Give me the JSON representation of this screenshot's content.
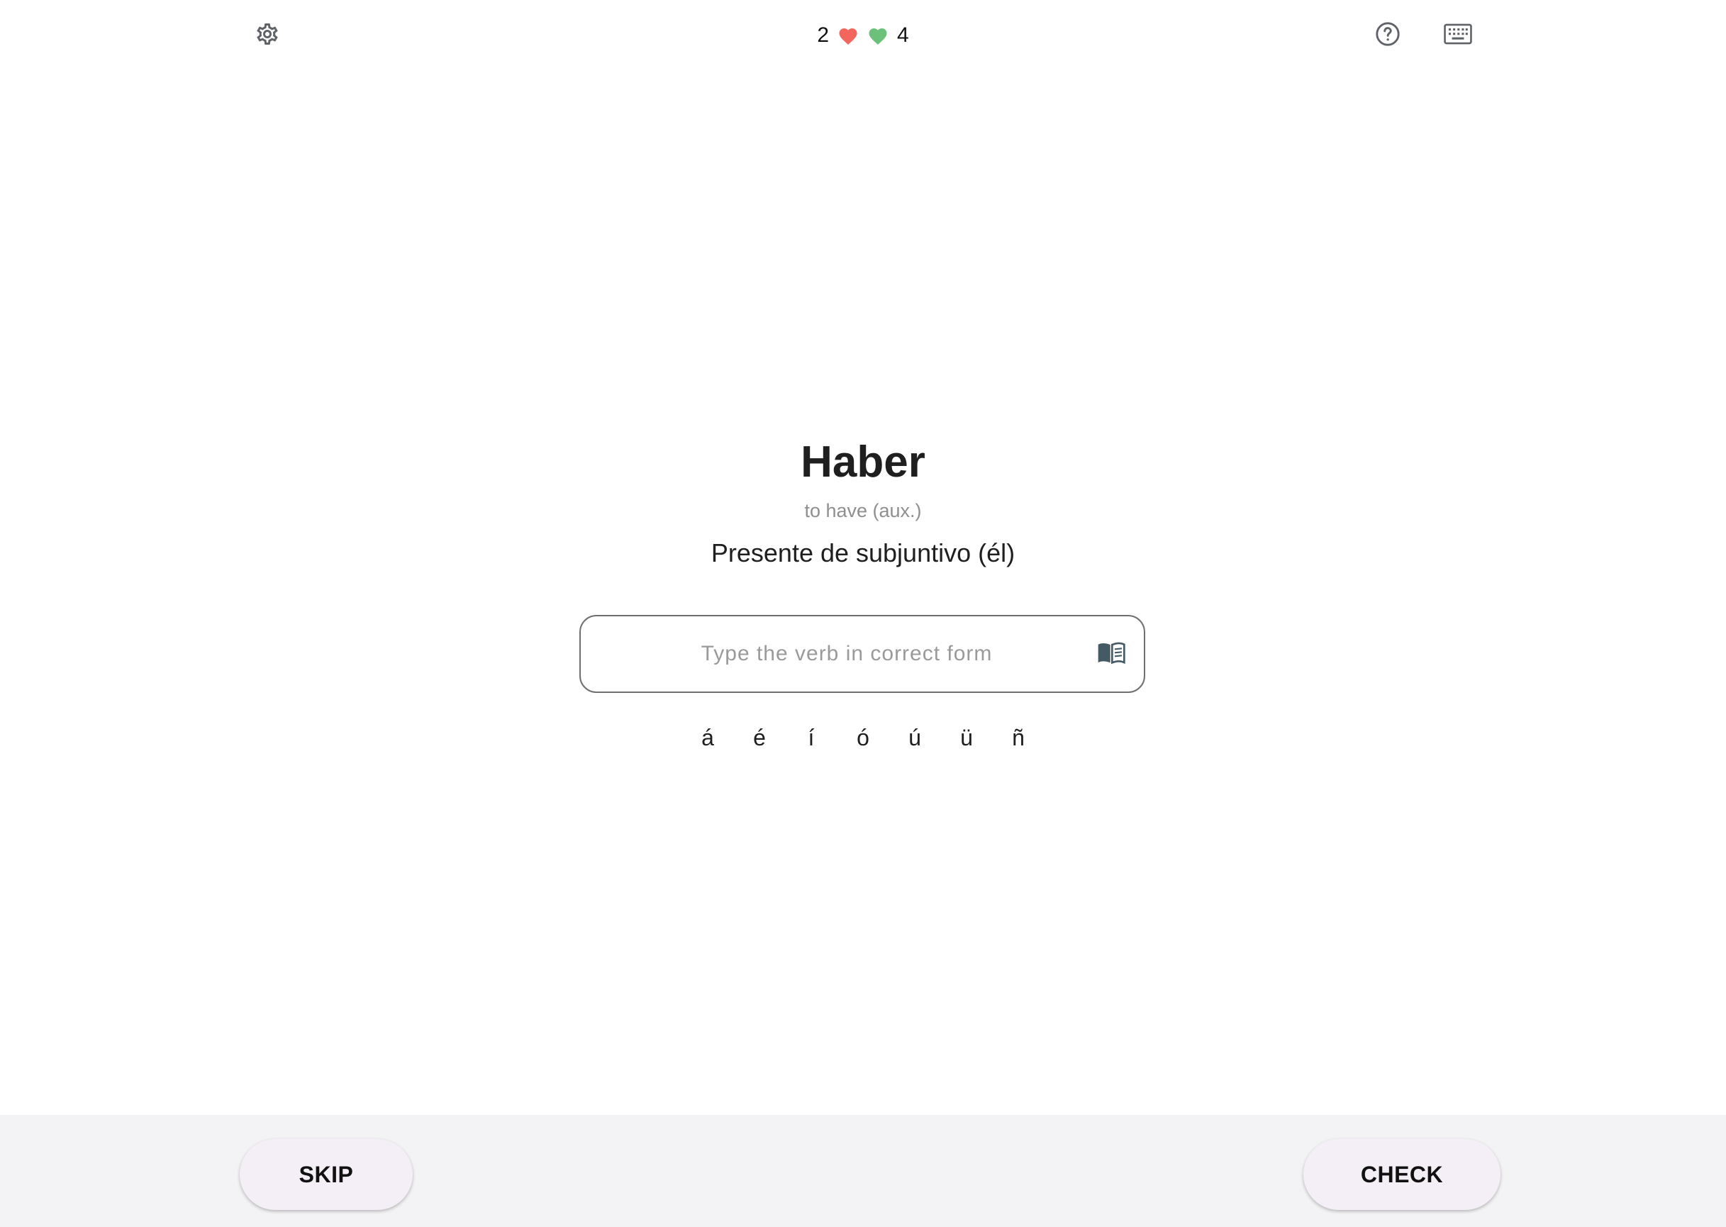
{
  "topbar": {
    "icons": {
      "settings": "gear-icon",
      "help": "question-circle-icon",
      "keyboard": "keyboard-icon"
    },
    "score": {
      "wrong_count": "2",
      "right_count": "4",
      "wrong_color": "#f2665e",
      "right_color": "#6cc17a"
    }
  },
  "main": {
    "verb": "Haber",
    "translation": "to have (aux.)",
    "tense": "Presente de subjuntivo (él)",
    "input": {
      "value": "",
      "placeholder": "Type the verb in correct form",
      "icon": "book-icon"
    },
    "accents": [
      "á",
      "é",
      "í",
      "ó",
      "ú",
      "ü",
      "ñ"
    ]
  },
  "bottombar": {
    "skip_label": "SKIP",
    "check_label": "CHECK"
  },
  "colors": {
    "bottom_bar_bg": "#f3f2f4",
    "button_bg": "#f4eff7"
  }
}
